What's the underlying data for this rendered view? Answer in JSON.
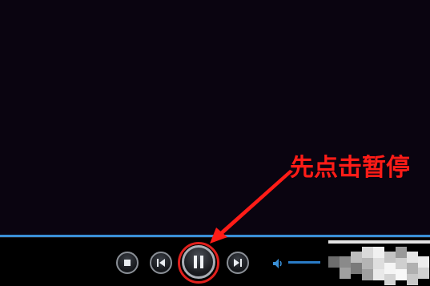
{
  "annotation": {
    "text": "先点击暂停",
    "color": "#ff1c17"
  },
  "player": {
    "seek_progress": 1.0,
    "accent_color": "#3a8fd6",
    "controls": {
      "stop_icon": "stop-icon",
      "previous_icon": "skip-previous-icon",
      "pause_icon": "pause-icon",
      "next_icon": "skip-next-icon",
      "volume_icon": "speaker-icon"
    },
    "volume_level": 0.6
  }
}
